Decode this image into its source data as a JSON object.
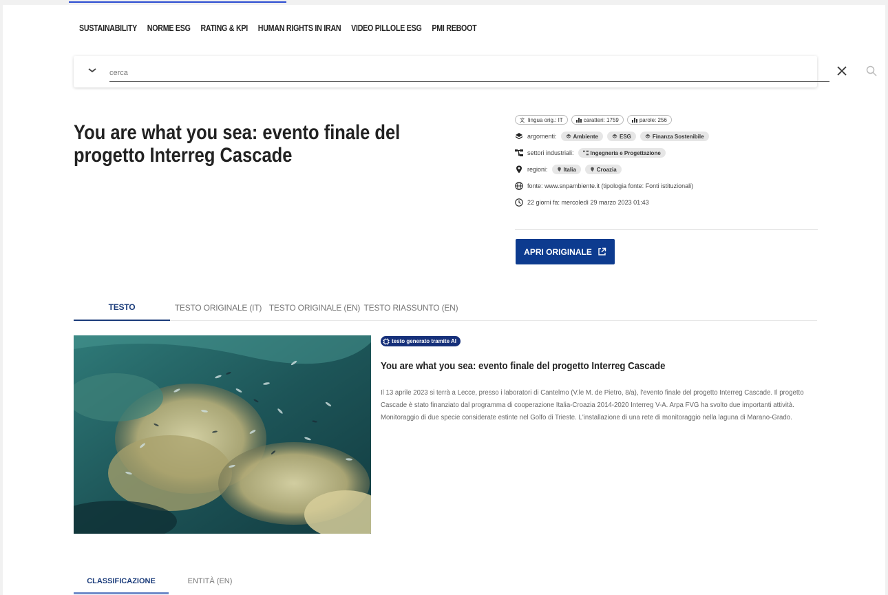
{
  "nav": {
    "items": [
      "SUSTAINABILITY",
      "NORME ESG",
      "RATING & KPI",
      "HUMAN RIGHTS IN IRAN",
      "VIDEO PILLOLE ESG",
      "PMI REBOOT"
    ]
  },
  "search": {
    "placeholder": "cerca"
  },
  "article": {
    "title": "You are what you sea: evento finale del progetto Interreg Cascade",
    "button_label": "APRI ORIGINALE"
  },
  "meta": {
    "chips": [
      "lingua orig.: IT",
      "caratteri: 1759",
      "parole: 256"
    ],
    "argomenti_label": "argomenti:",
    "argomenti": [
      "Ambiente",
      "ESG",
      "Finanza Sostenibile"
    ],
    "settori_label": "settori industriali:",
    "settori": [
      "Ingegneria e Progettazione"
    ],
    "regioni_label": "regioni:",
    "regioni": [
      "Italia",
      "Croazia"
    ],
    "fonte": "fonte: www.snpambiente.it (tipologia fonte: Fonti istituzionali)",
    "data": "22 giorni fa: mercoledì 29 marzo 2023 01:43"
  },
  "tabs": [
    "TESTO",
    "TESTO ORIGINALE (IT)",
    "TESTO ORIGINALE (EN)",
    "TESTO RIASSUNTO (EN)"
  ],
  "content": {
    "ai_badge": "testo generato tramite AI",
    "title": "You are what you sea: evento finale del progetto Interreg Cascade",
    "body": "Il 13 aprile 2023 si terrà a Lecce, presso i laboratori di Cantelmo (V.le M. de Pietro, 8/a), l'evento finale del progetto Interreg Cascade. Il progetto Cascade è stato finanziato dal programma di cooperazione Italia-Croazia 2014-2020 Interreg V-A. Arpa FVG ha svolto due importanti attività. Monitoraggio di due specie considerate estinte nel Golfo di Trieste. L'installazione di una rete di monitoraggio nella laguna di Marano-Grado."
  },
  "bottom_tabs": [
    "CLASSIFICAZIONE",
    "ENTITÀ (EN)"
  ],
  "colors": {
    "primary": "#0d3b8f",
    "badge": "#16307a",
    "active_tab": "#1a3b7a"
  }
}
